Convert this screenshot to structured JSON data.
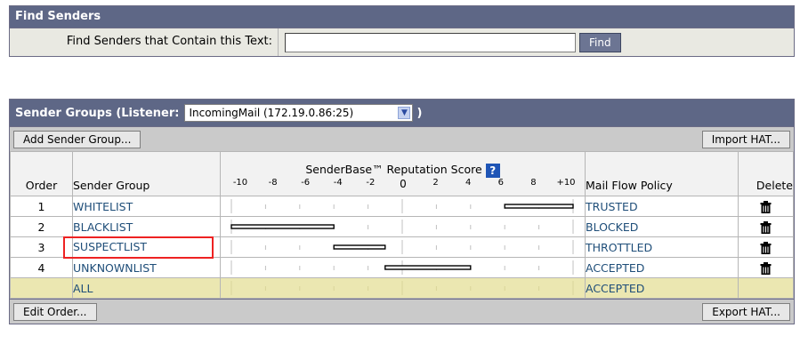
{
  "find_panel": {
    "title": "Find Senders",
    "label": "Find Senders that Contain this Text:",
    "input_value": "",
    "find_button": "Find"
  },
  "sender_groups": {
    "title": "Sender Groups (Listener:",
    "listener_value": "IncomingMail (172.19.0.86:25)",
    "after_select": ")",
    "add_button": "Add Sender Group...",
    "import_button": "Import HAT...",
    "edit_button": "Edit Order...",
    "export_button": "Export HAT...",
    "columns": {
      "order": "Order",
      "group": "Sender Group",
      "score": "SenderBase™ Reputation Score",
      "policy": "Mail Flow Policy",
      "delete": "Delete"
    },
    "ticks": [
      "-10",
      "-8",
      "-6",
      "-4",
      "-2",
      "0",
      "2",
      "4",
      "6",
      "8",
      "+10"
    ],
    "rows": [
      {
        "order": "1",
        "group": "WHITELIST",
        "policy": "TRUSTED",
        "range": [
          6,
          10
        ],
        "deletable": true
      },
      {
        "order": "2",
        "group": "BLACKLIST",
        "policy": "BLOCKED",
        "range": [
          -10,
          -4
        ],
        "deletable": true
      },
      {
        "order": "3",
        "group": "SUSPECTLIST",
        "policy": "THROTTLED",
        "range": [
          -4,
          -1
        ],
        "deletable": true,
        "highlighted": true
      },
      {
        "order": "4",
        "group": "UNKNOWNLIST",
        "policy": "ACCEPTED",
        "range": [
          -1,
          4
        ],
        "deletable": true
      },
      {
        "order": "",
        "group": "ALL",
        "policy": "ACCEPTED",
        "range": null,
        "deletable": false
      }
    ]
  },
  "icons": {
    "help": "?",
    "dropdown": "chevron-down-icon",
    "delete": "trash-icon"
  },
  "colors": {
    "header_bg": "#5e6786",
    "all_row_bg": "#ebe7b1",
    "highlight": "#e22222",
    "link": "#1f4e79"
  }
}
